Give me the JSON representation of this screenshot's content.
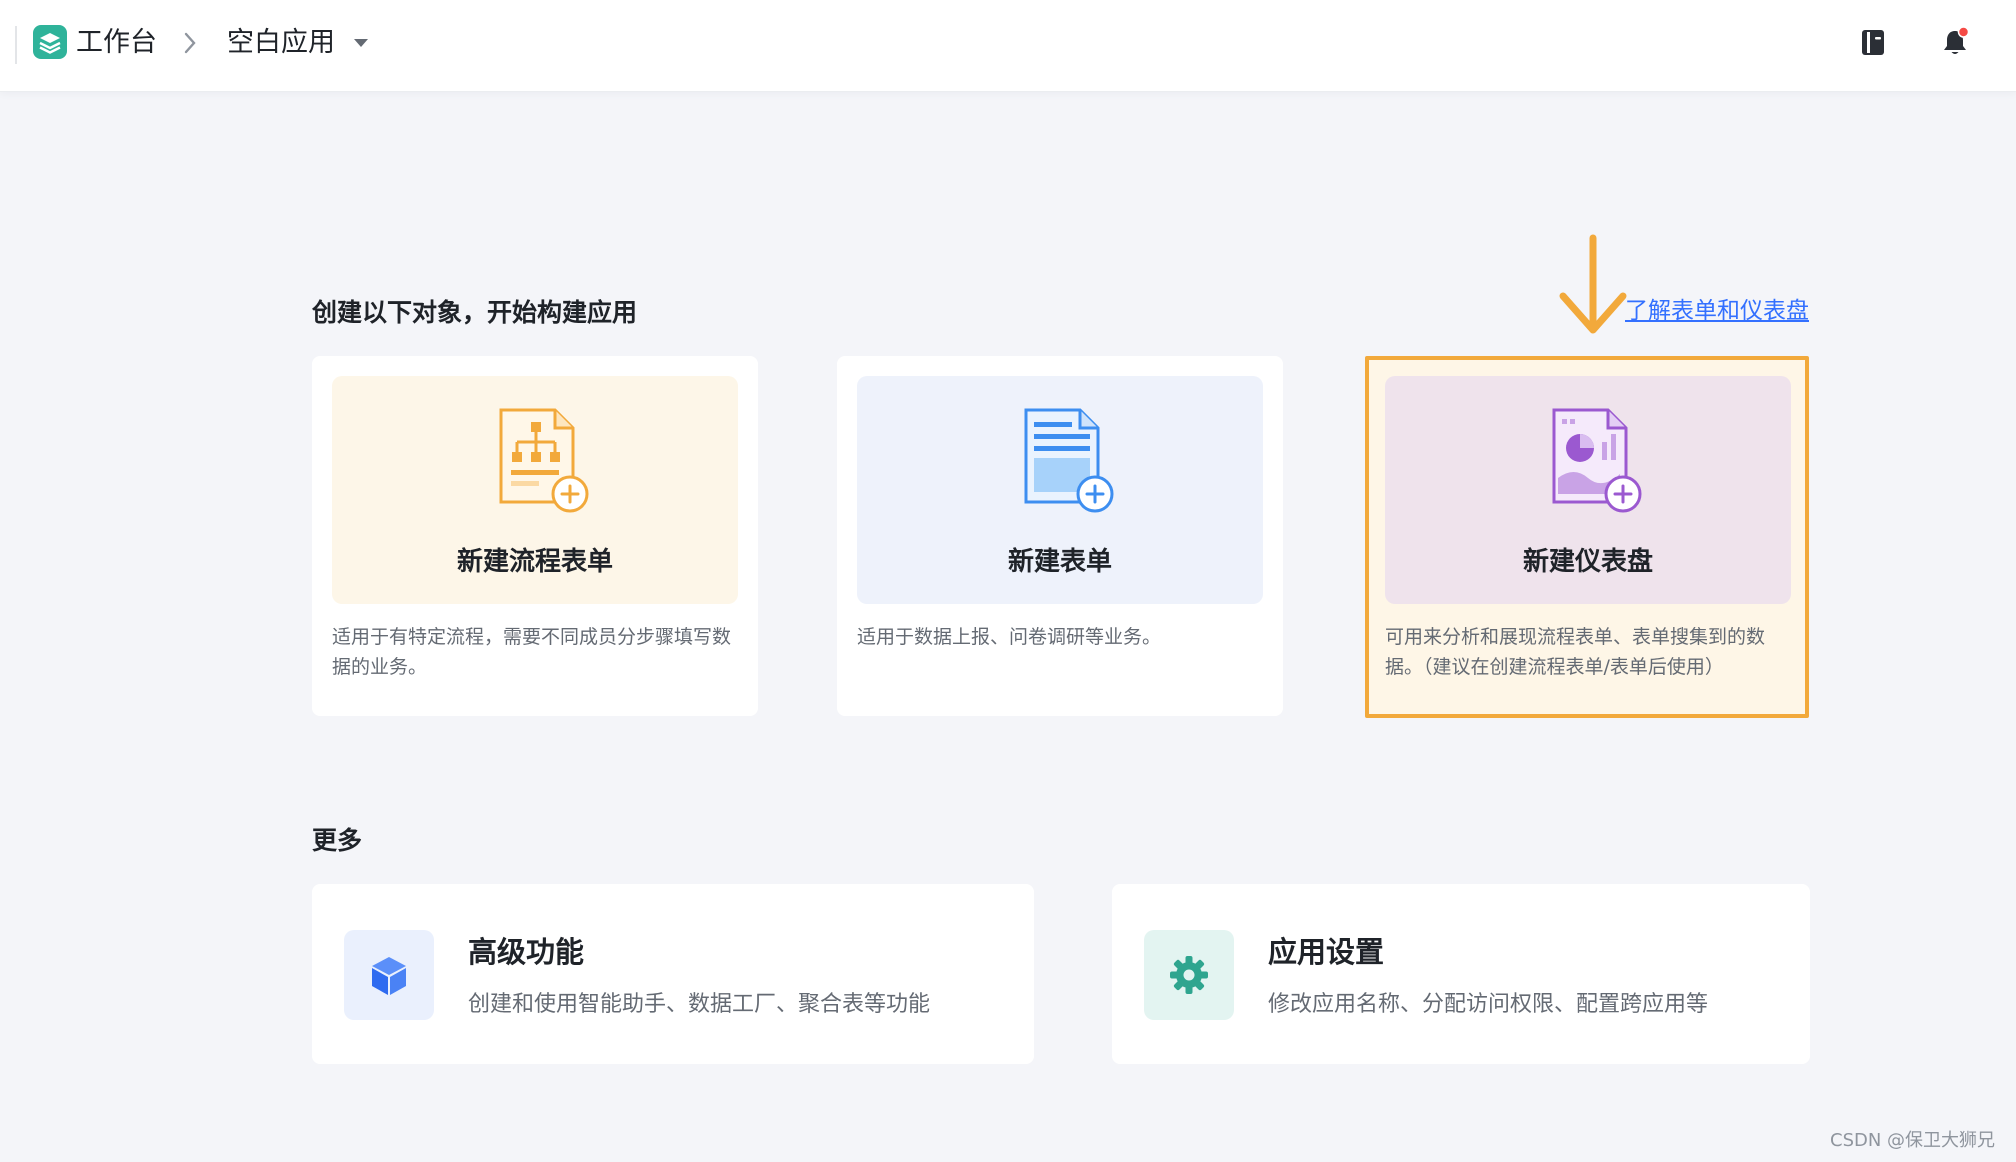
{
  "breadcrumb": {
    "home": "工作台",
    "app": "空白应用"
  },
  "header_icons": {
    "doc": "book-icon",
    "bell": "bell-icon",
    "bell_badge_color": "#f54a45"
  },
  "create_section": {
    "title": "创建以下对象，开始构建应用",
    "learn_link": "了解表单和仪表盘",
    "cards": [
      {
        "label": "新建流程表单",
        "icon": "flow-form-icon",
        "description": "适用于有特定流程，需要不同成员分步骤填写数据的业务。"
      },
      {
        "label": "新建表单",
        "icon": "form-icon",
        "description": "适用于数据上报、问卷调研等业务。"
      },
      {
        "label": "新建仪表盘",
        "icon": "dashboard-icon",
        "description": "可用来分析和展现流程表单、表单搜集到的数据。（建议在创建流程表单/表单后使用）"
      }
    ]
  },
  "more_section": {
    "title": "更多",
    "items": [
      {
        "title": "高级功能",
        "description": "创建和使用智能助手、数据工厂、聚合表等功能",
        "icon": "cube-icon"
      },
      {
        "title": "应用设置",
        "description": "修改应用名称、分配访问权限、配置跨应用等",
        "icon": "gear-icon"
      }
    ]
  },
  "colors": {
    "accent_link": "#3370ff",
    "highlight_border": "#f2a93b",
    "annotation_arrow": "#f2a93b"
  },
  "watermark": "CSDN @保卫大狮兄"
}
